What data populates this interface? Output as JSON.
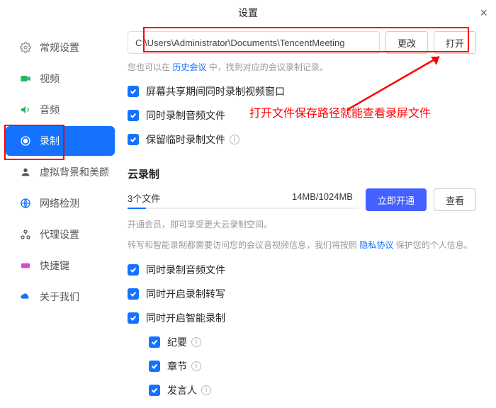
{
  "title": "设置",
  "sidebar": {
    "items": [
      {
        "label": "常规设置"
      },
      {
        "label": "视频"
      },
      {
        "label": "音频"
      },
      {
        "label": "录制"
      },
      {
        "label": "虚拟背景和美颜"
      },
      {
        "label": "网络检测"
      },
      {
        "label": "代理设置"
      },
      {
        "label": "快捷键"
      },
      {
        "label": "关于我们"
      }
    ]
  },
  "main": {
    "path": "C:\\Users\\Administrator\\Documents\\TencentMeeting",
    "btn_change": "更改",
    "btn_open": "打开",
    "note_pre": "您也可以在 ",
    "note_link": "历史会议",
    "note_post": " 中，找到对应的会议录制记录。",
    "chk_screen": "屏幕共享期间同时录制视频窗口",
    "chk_audio1": "同时录制音频文件",
    "chk_temp": "保留临时录制文件",
    "cloud": {
      "title": "云录制",
      "files": "3个文件",
      "size": "14MB/1024MB",
      "btn_open": "立即开通",
      "btn_view": "查看",
      "note1": "开通会员，即可享受更大云录制空间。",
      "note2_pre": "转写和智能录制都需要访问您的会议音视频信息，我们将按照 ",
      "note2_link": "隐私协议",
      "note2_post": " 保护您的个人信息。"
    },
    "chk_audio2": "同时录制音频文件",
    "chk_trans": "同时开启录制转写",
    "chk_smart": "同时开启智能录制",
    "chk_summary": "纪要",
    "chk_chapter": "章节",
    "chk_speaker": "发言人"
  },
  "annotation": "打开文件保存路径就能查看录屏文件"
}
